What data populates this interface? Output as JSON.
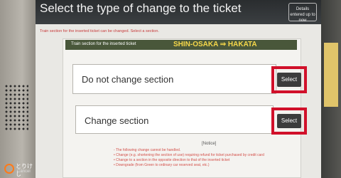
{
  "header": {
    "title": "Select the type of change to the ticket",
    "details_button": "Details entered up to now"
  },
  "top_notice": "Train section for the inserted ticket can be changed. Select a section.",
  "section_bar": {
    "label": "Train section for the inserted ticket",
    "route": "SHIN-OSAKA ⇒ HAKATA"
  },
  "options": [
    {
      "label": "Do not change section",
      "button": "Select"
    },
    {
      "label": "Change section",
      "button": "Select"
    }
  ],
  "notice": {
    "heading": "[Notice]",
    "lines": [
      "- The following change cannot be handled.",
      "  • Change (e.g. shortening the section of use) requiring refund for ticket purchased by credit card",
      "  • Change to a section in the opposite direction to that of the inserted ticket",
      "  • Downgrade (from Green to ordinary car reserved seat, etc.)"
    ]
  },
  "cancel": {
    "jp": "とりけし",
    "en": "Cancel"
  },
  "colors": {
    "highlight": "#d1102a",
    "bar": "#49573a",
    "route": "#f6d84a"
  }
}
